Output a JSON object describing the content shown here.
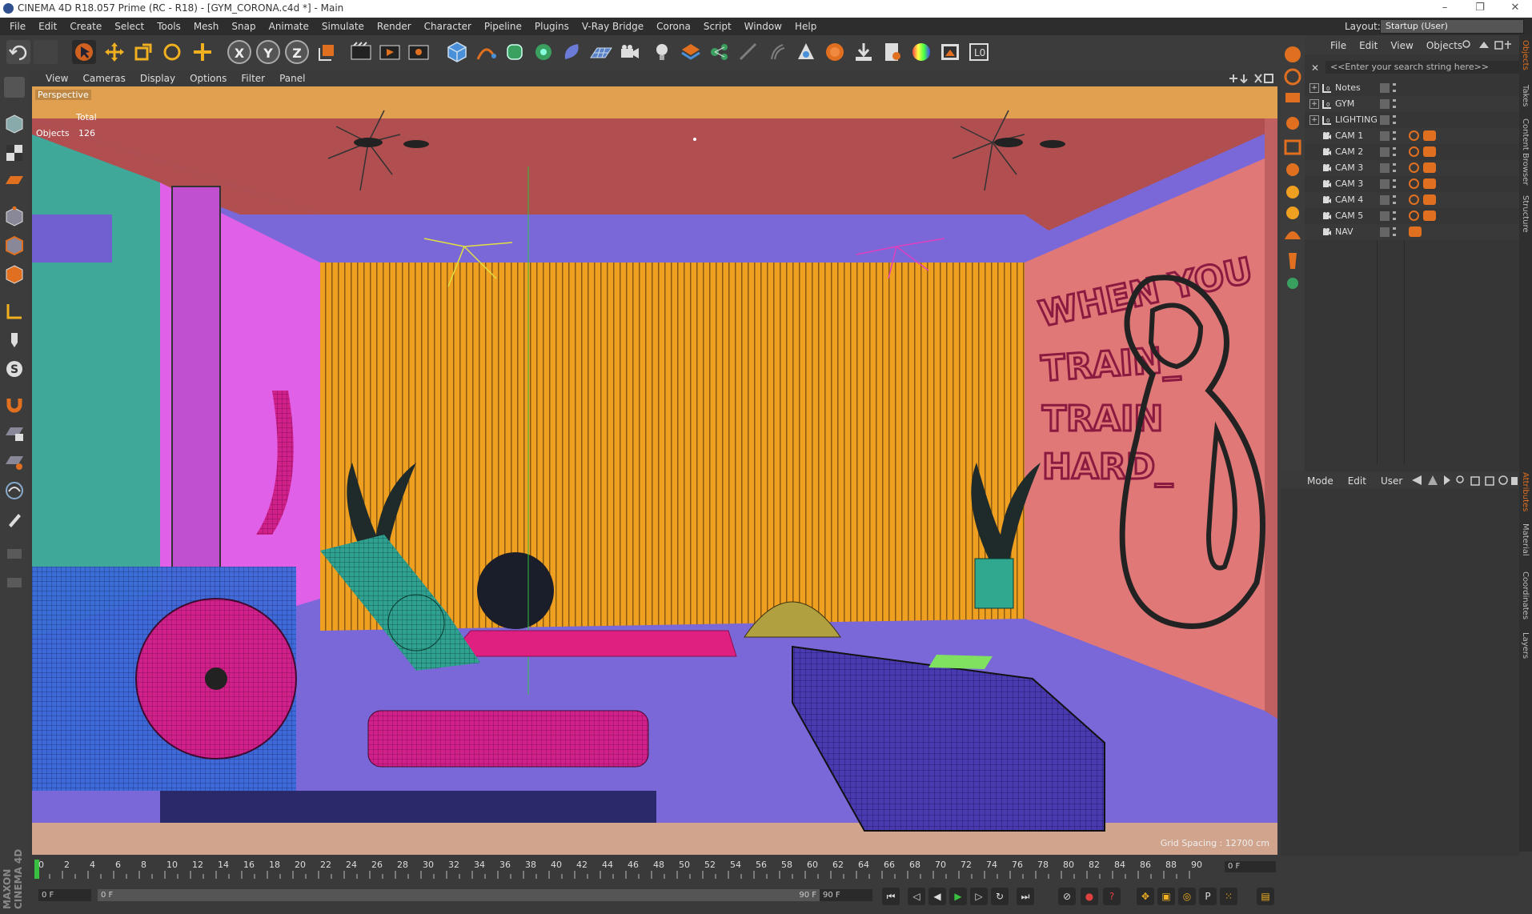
{
  "window": {
    "title": "CINEMA 4D R18.057 Prime (RC - R18) - [GYM_CORONA.c4d *] - Main",
    "min": "–",
    "max": "❐",
    "close": "✕"
  },
  "menubar": {
    "items": [
      "File",
      "Edit",
      "Create",
      "Select",
      "Tools",
      "Mesh",
      "Snap",
      "Animate",
      "Simulate",
      "Render",
      "Character",
      "Pipeline",
      "Plugins",
      "V-Ray Bridge",
      "Corona",
      "Script",
      "Window",
      "Help"
    ],
    "layout_label": "Layout:",
    "layout_value": "Startup (User)"
  },
  "toolbar": {
    "axis_x": "X",
    "axis_y": "Y",
    "axis_z": "Z"
  },
  "viewport": {
    "menu": [
      "View",
      "Cameras",
      "Display",
      "Options",
      "Filter",
      "Panel"
    ],
    "camera": "Perspective",
    "total_label": "Total",
    "objects_label": "Objects",
    "objects_count": "126",
    "grid_spacing": "Grid Spacing : 12700 cm",
    "wall_text": [
      "WHEN YOU",
      "TRAIN_",
      "TRAIN",
      "HARD_"
    ]
  },
  "objects": {
    "menu": [
      "File",
      "Edit",
      "View",
      "Objects"
    ],
    "search_placeholder": "<<Enter your search string here>>",
    "rows": [
      {
        "name": "Notes"
      },
      {
        "name": "GYM"
      },
      {
        "name": "LIGHTING"
      },
      {
        "name": "CAM 1"
      },
      {
        "name": "CAM 2"
      },
      {
        "name": "CAM 3"
      },
      {
        "name": "CAM 3"
      },
      {
        "name": "CAM 4"
      },
      {
        "name": "CAM 5"
      },
      {
        "name": "NAV"
      }
    ]
  },
  "attributes": {
    "menu": [
      "Mode",
      "Edit",
      "User"
    ]
  },
  "side_tabs": [
    "Objects",
    "Takes",
    "Content Browser",
    "Structure",
    "Attributes",
    "Material",
    "Coordinates",
    "Layers"
  ],
  "timeline": {
    "ticks": [
      "0",
      "2",
      "4",
      "6",
      "8",
      "10",
      "12",
      "14",
      "16",
      "18",
      "20",
      "22",
      "24",
      "26",
      "28",
      "30",
      "32",
      "34",
      "36",
      "38",
      "40",
      "42",
      "44",
      "46",
      "48",
      "50",
      "52",
      "54",
      "56",
      "58",
      "60",
      "62",
      "64",
      "66",
      "68",
      "70",
      "72",
      "74",
      "76",
      "78",
      "80",
      "82",
      "84",
      "86",
      "88",
      "90"
    ],
    "current_frame": "0 F"
  },
  "transport": {
    "start": "0 F",
    "slider_start": "0 F",
    "slider_end": "90 F",
    "end": "90 F"
  },
  "brand": "MAXON CINEMA 4D",
  "colors": {
    "accent": "#e07020",
    "viewport_floor": "#7b68d8",
    "wall_back": "#f0a020",
    "ceiling": "#b04e50",
    "wall_right": "#e07878",
    "wall_left": "#e060e8"
  }
}
